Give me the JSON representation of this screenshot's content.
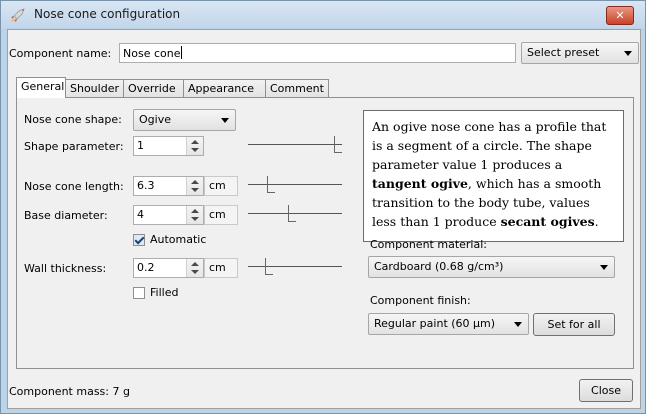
{
  "window": {
    "title": "Nose cone configuration",
    "close_glyph": "✕"
  },
  "component_name": {
    "label": "Component name:",
    "value": "Nose cone"
  },
  "preset": {
    "label": "Select preset"
  },
  "tabs": [
    {
      "label": "General",
      "active": true
    },
    {
      "label": "Shoulder"
    },
    {
      "label": "Override"
    },
    {
      "label": "Appearance"
    },
    {
      "label": "Comment"
    }
  ],
  "general": {
    "shape": {
      "label": "Nose cone shape:",
      "value": "Ogive"
    },
    "shape_param": {
      "label": "Shape parameter:",
      "value": "1",
      "slider_fraction": 1.0
    },
    "length": {
      "label": "Nose cone length:",
      "value": "6.3",
      "unit": "cm",
      "slider_fraction": 0.22
    },
    "base_diameter": {
      "label": "Base diameter:",
      "value": "4",
      "unit": "cm",
      "slider_fraction": 0.47
    },
    "automatic": {
      "label": "Automatic",
      "checked": true
    },
    "wall_thickness": {
      "label": "Wall thickness:",
      "value": "0.2",
      "unit": "cm",
      "slider_fraction": 0.2
    },
    "filled": {
      "label": "Filled",
      "checked": false
    },
    "description": {
      "p1": "An ogive nose cone has a profile that is a segment of a circle. The shape parameter value 1 produces a ",
      "b1": "tangent ogive",
      "p2": ", which has a smooth transition to the body tube, values less than 1 produce ",
      "b2": "secant ogives",
      "p3": "."
    },
    "material": {
      "label": "Component material:",
      "value": "Cardboard (0.68 g/cm³)"
    },
    "finish": {
      "label": "Component finish:",
      "value": "Regular paint (60 µm)",
      "set_all": "Set for all"
    }
  },
  "footer": {
    "mass": "Component mass: 7 g",
    "close": "Close"
  },
  "colors": {
    "accent": "#c7432b",
    "titlebar": "#c2d6ea"
  },
  "icons": {
    "app": "rocket-icon"
  }
}
